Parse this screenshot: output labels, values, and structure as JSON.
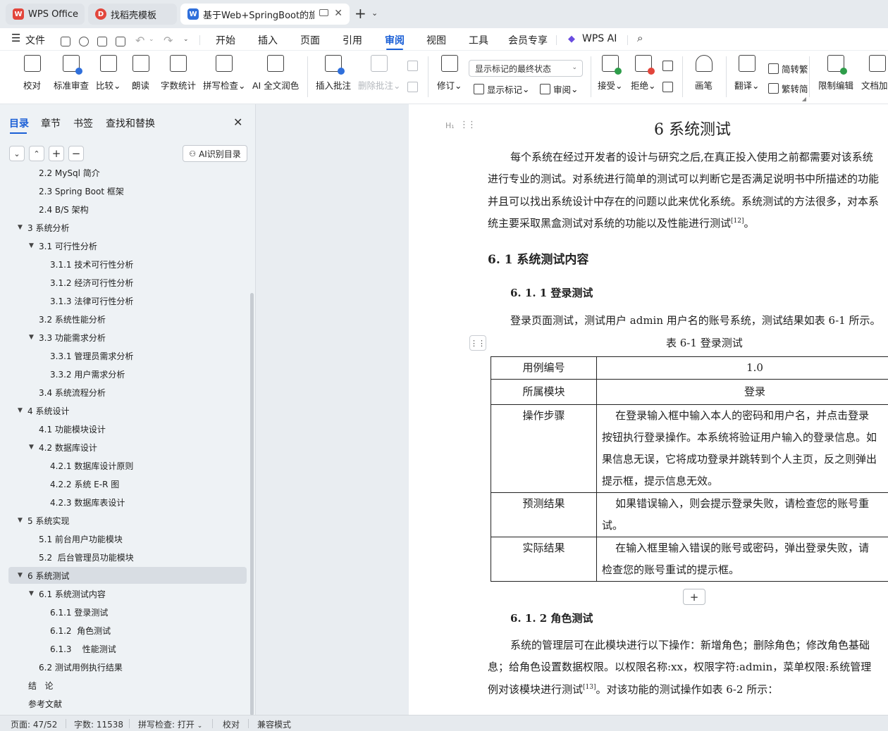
{
  "tabs": [
    {
      "label": "WPS Office",
      "active": false,
      "logo": "wps-logo-icon",
      "color": "#e2453b"
    },
    {
      "label": "找稻壳模板",
      "active": false,
      "logo": "docer-logo-icon",
      "color": "#e2453b"
    },
    {
      "label": "基于Web+SpringBoot的旅游",
      "active": true,
      "logo": "writer-logo-icon",
      "color": "#2f6fdb"
    }
  ],
  "menubar": {
    "file_label": "文件",
    "items": [
      "开始",
      "插入",
      "页面",
      "引用",
      "审阅",
      "视图",
      "工具",
      "会员专享"
    ],
    "active_item": "审阅",
    "wps_ai_label": "WPS AI"
  },
  "ribbon": {
    "buttons": [
      "校对",
      "标准审查",
      "比较",
      "朗读",
      "字数统计",
      "拼写检查",
      "AI 全文润色",
      "插入批注",
      "删除批注"
    ],
    "markup_select": "显示标记的最终状态",
    "revise": "修订",
    "show_markup": "显示标记",
    "review": "审阅",
    "accept": "接受",
    "reject": "拒绝",
    "pen": "画笔",
    "translate": "翻译",
    "to_traditional": "简转繁",
    "to_simplified": "繁转简",
    "restrict_edit": "限制编辑",
    "doc_encrypt": "文档加密"
  },
  "nav": {
    "tabs": [
      "目录",
      "章节",
      "书签",
      "查找和替换"
    ],
    "active_tab": "目录",
    "ai_toc_label": "AI识别目录",
    "toc": [
      {
        "text": "2.2 MySql 简介",
        "level": 2,
        "caret": false
      },
      {
        "text": "2.3 Spring Boot 框架",
        "level": 2,
        "caret": false
      },
      {
        "text": "2.4 B/S 架构",
        "level": 2,
        "caret": false
      },
      {
        "text": "3 系统分析",
        "level": 1,
        "caret": true
      },
      {
        "text": "3.1 可行性分析",
        "level": 2,
        "caret": true
      },
      {
        "text": "3.1.1 技术可行性分析",
        "level": 3,
        "caret": false
      },
      {
        "text": "3.1.2 经济可行性分析",
        "level": 3,
        "caret": false
      },
      {
        "text": "3.1.3 法律可行性分析",
        "level": 3,
        "caret": false
      },
      {
        "text": "3.2 系统性能分析",
        "level": 2,
        "caret": false
      },
      {
        "text": "3.3 功能需求分析",
        "level": 2,
        "caret": true
      },
      {
        "text": "3.3.1 管理员需求分析",
        "level": 3,
        "caret": false
      },
      {
        "text": "3.3.2 用户需求分析",
        "level": 3,
        "caret": false
      },
      {
        "text": "3.4 系统流程分析",
        "level": 2,
        "caret": false
      },
      {
        "text": "4 系统设计",
        "level": 1,
        "caret": true
      },
      {
        "text": "4.1 功能模块设计",
        "level": 2,
        "caret": false
      },
      {
        "text": "4.2 数据库设计",
        "level": 2,
        "caret": true
      },
      {
        "text": "4.2.1 数据库设计原则",
        "level": 3,
        "caret": false
      },
      {
        "text": "4.2.2 系统 E-R 图",
        "level": 3,
        "caret": false
      },
      {
        "text": "4.2.3 数据库表设计",
        "level": 3,
        "caret": false
      },
      {
        "text": "5 系统实现",
        "level": 1,
        "caret": true
      },
      {
        "text": "5.1 前台用户功能模块",
        "level": 2,
        "caret": false
      },
      {
        "text": "5.2  后台管理员功能模块",
        "level": 2,
        "caret": false
      },
      {
        "text": "6 系统测试",
        "level": 1,
        "caret": true,
        "selected": true
      },
      {
        "text": "6.1 系统测试内容",
        "level": 2,
        "caret": true
      },
      {
        "text": "6.1.1 登录测试",
        "level": 3,
        "caret": false
      },
      {
        "text": "6.1.2  角色测试",
        "level": 3,
        "caret": false
      },
      {
        "text": "6.1.3    性能测试",
        "level": 3,
        "caret": false
      },
      {
        "text": "6.2 测试用例执行结果",
        "level": 2,
        "caret": false
      },
      {
        "text": "结   论",
        "level": 0,
        "caret": false
      },
      {
        "text": "参考文献",
        "level": 0,
        "caret": false
      }
    ]
  },
  "doc": {
    "title": "6 系统测试",
    "intro": [
      "每个系统在经过开发者的设计与研究之后,在真正投入使用之前都需要对该系统",
      "进行专业的测试。对系统进行简单的测试可以判断它是否满足说明书中所描述的功能",
      "并且可以找出系统设计中存在的问题以此来优化系统。系统测试的方法很多，对本系",
      "统主要采取黑盒测试对系统的功能以及性能进行测试"
    ],
    "intro_ref": "[12]",
    "intro_end": "。",
    "h2": "6. 1 系统测试内容",
    "h3_login": "6. 1. 1 登录测试",
    "login_para": "登录页面测试，测试用户 admin 用户名的账号系统，测试结果如表 6-1 所示。",
    "table_caption": "表 6-1  登录测试",
    "table": {
      "case_no_label": "用例编号",
      "case_no": "1.0",
      "module_label": "所属模块",
      "module": "登录",
      "steps_label": "操作步骤",
      "steps": [
        "    在登录输入框中输入本人的密码和用户名，并点击登录",
        "按钮执行登录操作。本系统将验证用户输入的登录信息。如",
        "果信息无误，它将成功登录并跳转到个人主页，反之则弹出",
        "提示框，提示信息无效。"
      ],
      "expected_label": "预测结果",
      "expected": [
        "    如果错误输入，则会提示登录失败，请检查您的账号重",
        "试。"
      ],
      "actual_label": "实际结果",
      "actual": [
        "    在输入框里输入错误的账号或密码，弹出登录失败，请",
        "检查您的账号重试的提示框。"
      ]
    },
    "h3_role": "6. 1. 2  角色测试",
    "role_para": [
      "系统的管理层可在此模块进行以下操作：新增角色；删除角色；修改角色基础",
      "息；给角色设置数据权限。以权限名称:xx，权限字符:admin，菜单权限:系统管理",
      "例对该模块进行测试"
    ],
    "role_ref": "[13]",
    "role_end": "。对该功能的测试操作如表 6-2 所示："
  },
  "status": {
    "page": "页面: 47/52",
    "words": "字数: 11538",
    "spell": "拼写检查: 打开",
    "proof": "校对",
    "compat": "兼容模式"
  }
}
